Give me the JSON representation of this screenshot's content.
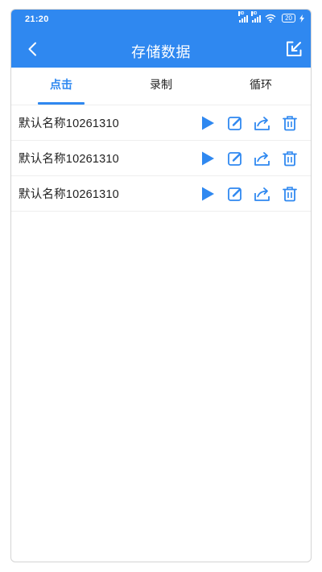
{
  "status_bar": {
    "time": "21:20",
    "signal_label_1": "HD",
    "signal_label_2": "HD",
    "battery": "20"
  },
  "app_bar": {
    "title": "存储数据",
    "back_icon": "chevron-left-icon",
    "import_icon": "import-arrow-icon"
  },
  "tabs": [
    {
      "label": "点击",
      "active": true
    },
    {
      "label": "录制",
      "active": false
    },
    {
      "label": "循环",
      "active": false
    }
  ],
  "records": [
    {
      "name": "默认名称10261310"
    },
    {
      "name": "默认名称10261310"
    },
    {
      "name": "默认名称10261310"
    }
  ],
  "row_actions": [
    "play-icon",
    "edit-icon",
    "share-icon",
    "trash-icon"
  ],
  "colors": {
    "primary": "#2f88f0",
    "text": "#222222",
    "divider": "#eeeeee",
    "background": "#ffffff"
  }
}
